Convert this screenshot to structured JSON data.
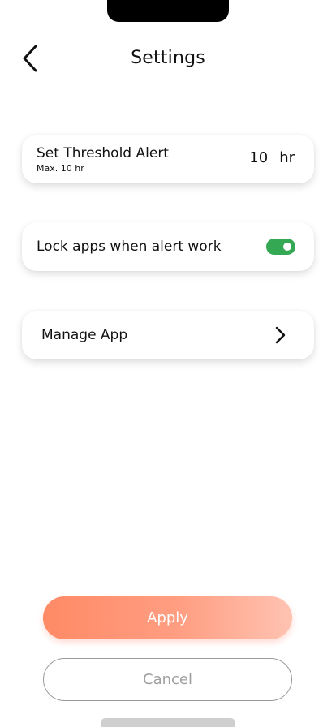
{
  "header": {
    "title": "Settings",
    "back_icon": "chevron-left-icon"
  },
  "threshold": {
    "label": "Set Threshold Alert",
    "sublabel": "Max. 10 hr",
    "value": "10",
    "unit": "hr"
  },
  "lock_apps": {
    "label": "Lock apps when alert work",
    "enabled": true,
    "toggle_color": "#34a853"
  },
  "manage_app": {
    "label": "Manage App",
    "icon": "chevron-right-icon"
  },
  "actions": {
    "apply_label": "Apply",
    "cancel_label": "Cancel",
    "apply_color": "#ff8a66"
  }
}
